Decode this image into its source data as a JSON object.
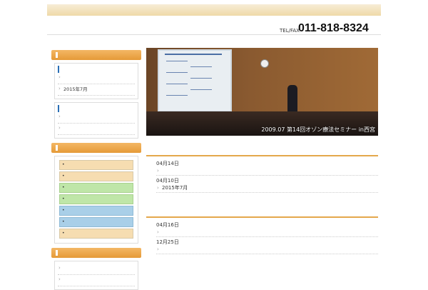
{
  "top_strip": {
    "text": ""
  },
  "header": {
    "title": "",
    "tel_label_jp": "",
    "tel_label": "TEL/FAX",
    "phone": "011-818-8324"
  },
  "breadcrumb": "",
  "sidebar": {
    "section1": {
      "title": "",
      "box1": {
        "title": "",
        "items": [
          "",
          "2015年7月"
        ]
      },
      "box2": {
        "title": "",
        "items": [
          "",
          ""
        ]
      }
    },
    "section2": {
      "title": "",
      "nav": [
        "",
        "",
        "",
        "",
        "",
        "",
        ""
      ]
    },
    "section3": {
      "title": "",
      "items": [
        "",
        ""
      ]
    }
  },
  "hero": {
    "caption": "2009.07 第14回オゾン療法セミナー in西宮"
  },
  "main": {
    "seminar": {
      "title": "",
      "entries": [
        {
          "date": "04月14日",
          "link": ""
        },
        {
          "date": "04月10日",
          "link": "2015年7月"
        }
      ]
    },
    "info": {
      "title": "",
      "entries": [
        {
          "date": "04月16日",
          "link": ""
        },
        {
          "date": "12月25日",
          "link": ""
        }
      ]
    }
  }
}
